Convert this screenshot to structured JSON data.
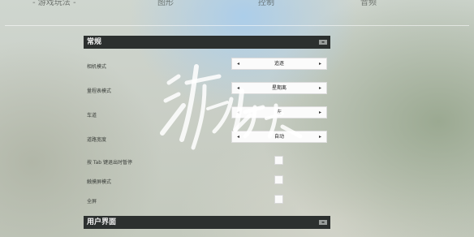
{
  "tabs": [
    "- 游戏玩法 -",
    "图形",
    "控制",
    "音频"
  ],
  "sections": {
    "general": {
      "title": "常规",
      "collapse_icon": "collapse-icon",
      "settings": {
        "camera_mode": {
          "label": "相机模式",
          "value": "追逐"
        },
        "dashboard_mode": {
          "label": "量程表模式",
          "value": "星期离"
        },
        "lane": {
          "label": "车道",
          "value": "左"
        },
        "road_width": {
          "label": "道路宽度",
          "value": "自动"
        },
        "tab_pause": {
          "label": "按 Tab 键退出时暂停",
          "checked": false
        },
        "touch_mode": {
          "label": "触摸屏模式",
          "checked": false
        },
        "fullscreen": {
          "label": "全屏",
          "checked": false
        }
      }
    },
    "ui": {
      "title": "用户界面",
      "collapse_icon": "collapse-icon"
    }
  },
  "arrows": {
    "left": "◂",
    "right": "▸"
  },
  "collapse_glyph": "▬",
  "watermark_icon": "brush-calligraphy-watermark-icon"
}
